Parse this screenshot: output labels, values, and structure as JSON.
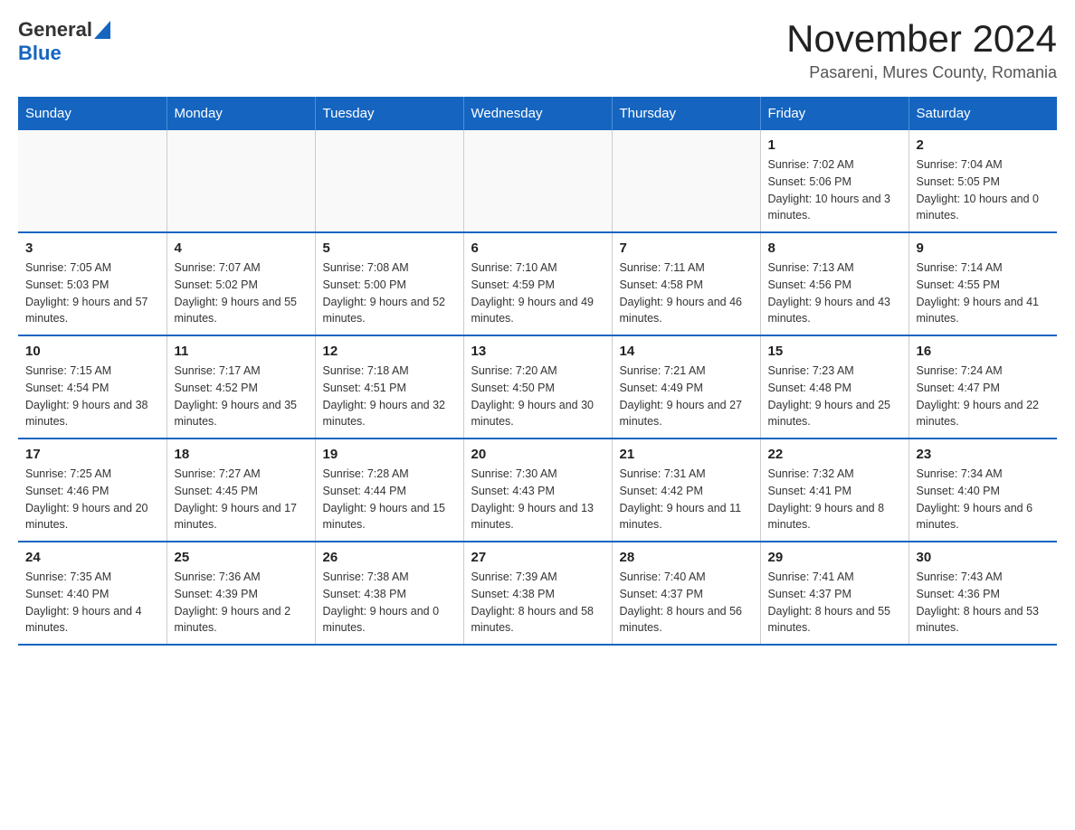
{
  "logo": {
    "general": "General",
    "blue": "Blue"
  },
  "title": "November 2024",
  "location": "Pasareni, Mures County, Romania",
  "days_of_week": [
    "Sunday",
    "Monday",
    "Tuesday",
    "Wednesday",
    "Thursday",
    "Friday",
    "Saturday"
  ],
  "weeks": [
    [
      {
        "day": "",
        "info": ""
      },
      {
        "day": "",
        "info": ""
      },
      {
        "day": "",
        "info": ""
      },
      {
        "day": "",
        "info": ""
      },
      {
        "day": "",
        "info": ""
      },
      {
        "day": "1",
        "info": "Sunrise: 7:02 AM\nSunset: 5:06 PM\nDaylight: 10 hours and 3 minutes."
      },
      {
        "day": "2",
        "info": "Sunrise: 7:04 AM\nSunset: 5:05 PM\nDaylight: 10 hours and 0 minutes."
      }
    ],
    [
      {
        "day": "3",
        "info": "Sunrise: 7:05 AM\nSunset: 5:03 PM\nDaylight: 9 hours and 57 minutes."
      },
      {
        "day": "4",
        "info": "Sunrise: 7:07 AM\nSunset: 5:02 PM\nDaylight: 9 hours and 55 minutes."
      },
      {
        "day": "5",
        "info": "Sunrise: 7:08 AM\nSunset: 5:00 PM\nDaylight: 9 hours and 52 minutes."
      },
      {
        "day": "6",
        "info": "Sunrise: 7:10 AM\nSunset: 4:59 PM\nDaylight: 9 hours and 49 minutes."
      },
      {
        "day": "7",
        "info": "Sunrise: 7:11 AM\nSunset: 4:58 PM\nDaylight: 9 hours and 46 minutes."
      },
      {
        "day": "8",
        "info": "Sunrise: 7:13 AM\nSunset: 4:56 PM\nDaylight: 9 hours and 43 minutes."
      },
      {
        "day": "9",
        "info": "Sunrise: 7:14 AM\nSunset: 4:55 PM\nDaylight: 9 hours and 41 minutes."
      }
    ],
    [
      {
        "day": "10",
        "info": "Sunrise: 7:15 AM\nSunset: 4:54 PM\nDaylight: 9 hours and 38 minutes."
      },
      {
        "day": "11",
        "info": "Sunrise: 7:17 AM\nSunset: 4:52 PM\nDaylight: 9 hours and 35 minutes."
      },
      {
        "day": "12",
        "info": "Sunrise: 7:18 AM\nSunset: 4:51 PM\nDaylight: 9 hours and 32 minutes."
      },
      {
        "day": "13",
        "info": "Sunrise: 7:20 AM\nSunset: 4:50 PM\nDaylight: 9 hours and 30 minutes."
      },
      {
        "day": "14",
        "info": "Sunrise: 7:21 AM\nSunset: 4:49 PM\nDaylight: 9 hours and 27 minutes."
      },
      {
        "day": "15",
        "info": "Sunrise: 7:23 AM\nSunset: 4:48 PM\nDaylight: 9 hours and 25 minutes."
      },
      {
        "day": "16",
        "info": "Sunrise: 7:24 AM\nSunset: 4:47 PM\nDaylight: 9 hours and 22 minutes."
      }
    ],
    [
      {
        "day": "17",
        "info": "Sunrise: 7:25 AM\nSunset: 4:46 PM\nDaylight: 9 hours and 20 minutes."
      },
      {
        "day": "18",
        "info": "Sunrise: 7:27 AM\nSunset: 4:45 PM\nDaylight: 9 hours and 17 minutes."
      },
      {
        "day": "19",
        "info": "Sunrise: 7:28 AM\nSunset: 4:44 PM\nDaylight: 9 hours and 15 minutes."
      },
      {
        "day": "20",
        "info": "Sunrise: 7:30 AM\nSunset: 4:43 PM\nDaylight: 9 hours and 13 minutes."
      },
      {
        "day": "21",
        "info": "Sunrise: 7:31 AM\nSunset: 4:42 PM\nDaylight: 9 hours and 11 minutes."
      },
      {
        "day": "22",
        "info": "Sunrise: 7:32 AM\nSunset: 4:41 PM\nDaylight: 9 hours and 8 minutes."
      },
      {
        "day": "23",
        "info": "Sunrise: 7:34 AM\nSunset: 4:40 PM\nDaylight: 9 hours and 6 minutes."
      }
    ],
    [
      {
        "day": "24",
        "info": "Sunrise: 7:35 AM\nSunset: 4:40 PM\nDaylight: 9 hours and 4 minutes."
      },
      {
        "day": "25",
        "info": "Sunrise: 7:36 AM\nSunset: 4:39 PM\nDaylight: 9 hours and 2 minutes."
      },
      {
        "day": "26",
        "info": "Sunrise: 7:38 AM\nSunset: 4:38 PM\nDaylight: 9 hours and 0 minutes."
      },
      {
        "day": "27",
        "info": "Sunrise: 7:39 AM\nSunset: 4:38 PM\nDaylight: 8 hours and 58 minutes."
      },
      {
        "day": "28",
        "info": "Sunrise: 7:40 AM\nSunset: 4:37 PM\nDaylight: 8 hours and 56 minutes."
      },
      {
        "day": "29",
        "info": "Sunrise: 7:41 AM\nSunset: 4:37 PM\nDaylight: 8 hours and 55 minutes."
      },
      {
        "day": "30",
        "info": "Sunrise: 7:43 AM\nSunset: 4:36 PM\nDaylight: 8 hours and 53 minutes."
      }
    ]
  ]
}
